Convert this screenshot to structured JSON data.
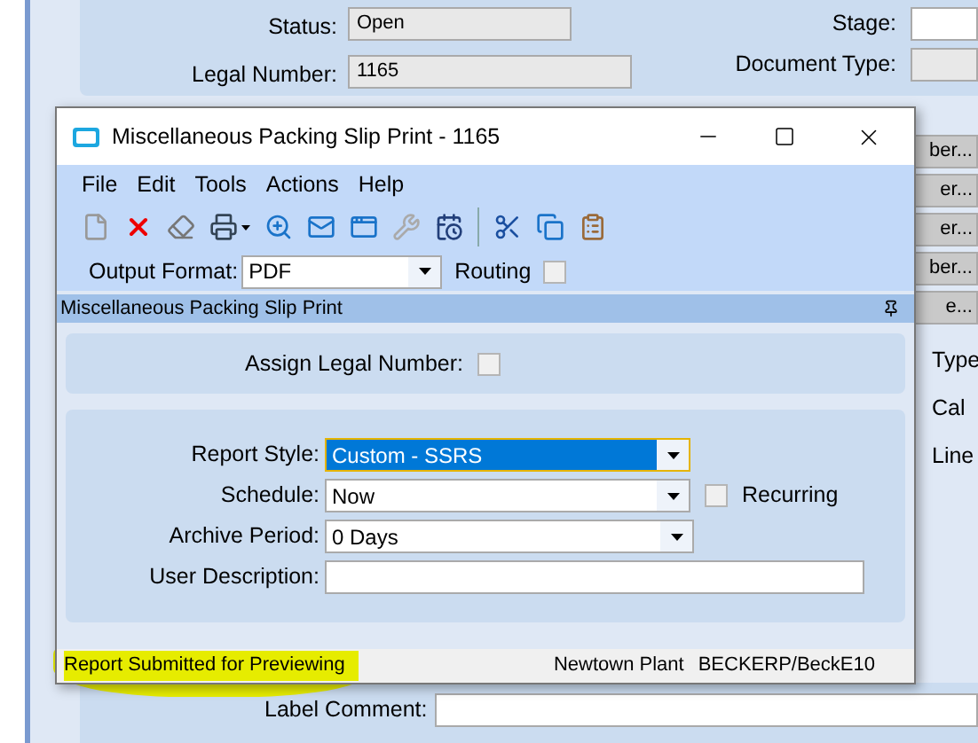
{
  "background": {
    "fields": [
      {
        "label": "Status:",
        "value": "Open"
      },
      {
        "label": "Legal Number:",
        "value": "1165"
      }
    ],
    "right_labels": [
      "Stage:",
      "Document Type:"
    ],
    "side_buttons": [
      "ber...",
      "er...",
      "er...",
      "ber...",
      "e..."
    ],
    "side_labels": [
      "Type",
      "Cal",
      "Line"
    ],
    "label_comment": {
      "label": "Label Comment:"
    }
  },
  "dialog": {
    "title": "Miscellaneous Packing Slip Print - 1165",
    "menu": [
      "File",
      "Edit",
      "Tools",
      "Actions",
      "Help"
    ],
    "output_format": {
      "label": "Output Format:",
      "value": "PDF"
    },
    "routing": {
      "label": "Routing",
      "checked": false
    },
    "section_title": "Miscellaneous Packing Slip Print",
    "assign_legal_number": {
      "label": "Assign Legal Number:",
      "checked": false
    },
    "report_style": {
      "label": "Report Style:",
      "value": "Custom - SSRS",
      "selected": true
    },
    "schedule": {
      "label": "Schedule:",
      "value": "Now",
      "selected": false
    },
    "recurring": {
      "label": "Recurring",
      "checked": false
    },
    "archive_period": {
      "label": "Archive Period:",
      "value": "0 Days",
      "selected": false
    },
    "user_description": {
      "label": "User Description:"
    },
    "status_bar": {
      "message": "Report Submitted for Previewing",
      "highlighted": true,
      "plant": "Newtown Plant",
      "user": "BECKERP/BeckE10"
    }
  }
}
